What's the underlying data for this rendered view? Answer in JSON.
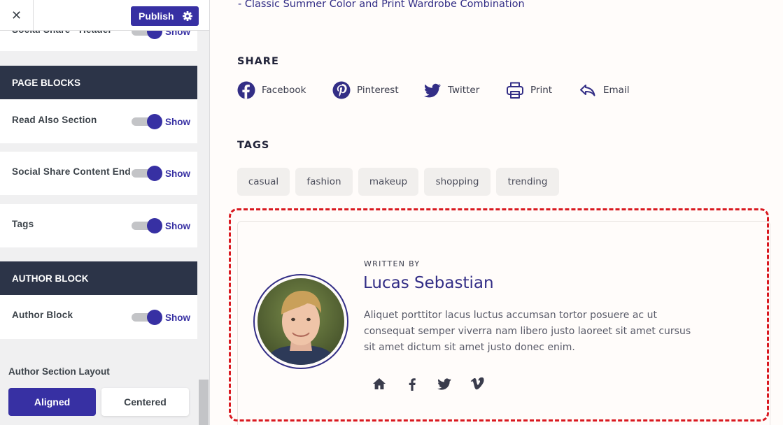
{
  "customizer": {
    "publish_label": "Publish",
    "partial_row": {
      "label": "Social Share - Header",
      "toggle": "Show"
    },
    "sections": [
      {
        "title": "PAGE BLOCKS"
      },
      {
        "title": "AUTHOR BLOCK"
      }
    ],
    "rows": [
      {
        "label": "Read Also Section",
        "toggle": "Show",
        "on": true
      },
      {
        "label": "Social Share Content End",
        "toggle": "Show",
        "on": true
      },
      {
        "label": "Tags",
        "toggle": "Show",
        "on": true
      },
      {
        "label": "Author Block",
        "toggle": "Show",
        "on": true
      }
    ],
    "layout_label": "Author Section Layout",
    "layout_options": [
      "Aligned",
      "Centered"
    ],
    "layout_selected": "Aligned"
  },
  "preview": {
    "related_link": "-  Classic Summer Color and Print Wardrobe Combination",
    "share_heading": "SHARE",
    "share_items": [
      {
        "label": "Facebook",
        "icon": "facebook-icon"
      },
      {
        "label": "Pinterest",
        "icon": "pinterest-icon"
      },
      {
        "label": "Twitter",
        "icon": "twitter-icon"
      },
      {
        "label": "Print",
        "icon": "print-icon"
      },
      {
        "label": "Email",
        "icon": "email-icon"
      }
    ],
    "tags_heading": "TAGS",
    "tags": [
      "casual",
      "fashion",
      "makeup",
      "shopping",
      "trending"
    ],
    "author": {
      "written_by": "WRITTEN BY",
      "name": "Lucas Sebastian",
      "bio": "Aliquet porttitor lacus luctus accumsan tortor posuere ac ut consequat semper viverra nam libero justo laoreet sit amet cursus sit amet dictum sit amet justo donec enim.",
      "socials": [
        "home-icon",
        "facebook-icon",
        "twitter-icon",
        "vimeo-icon"
      ]
    },
    "colors": {
      "accent": "#332e86",
      "highlight": "#d9181f",
      "section_head": "#2c3448"
    }
  }
}
